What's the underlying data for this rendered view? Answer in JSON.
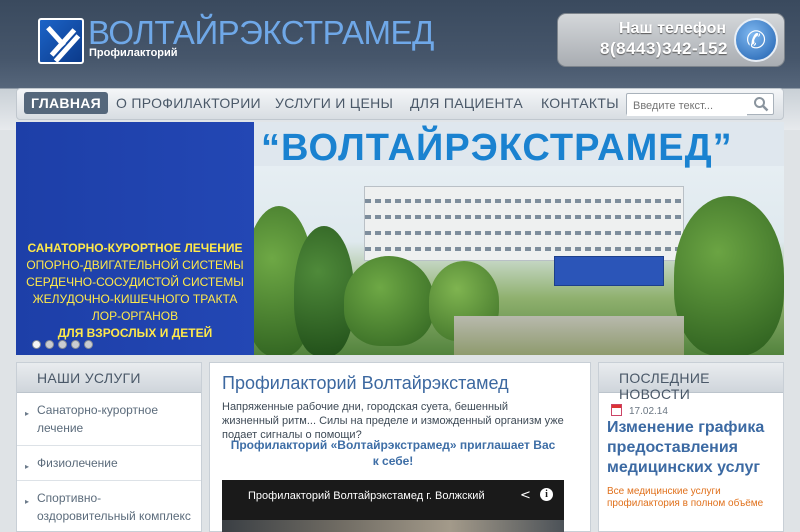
{
  "header": {
    "brand_title": "ВОЛТАЙРЭКСТРАМЕД",
    "brand_subtitle": "Профилакторий",
    "phone_label": "Наш телефон",
    "phone_number": "8(8443)342-152",
    "phone_icon": "phone-handset-icon",
    "logo_icon": "hand-logo-icon"
  },
  "nav": {
    "items": [
      {
        "label": "ГЛАВНАЯ",
        "active": true
      },
      {
        "label": "О ПРОФИЛАКТОРИИ",
        "active": false
      },
      {
        "label": "УСЛУГИ И ЦЕНЫ",
        "active": false
      },
      {
        "label": "ДЛЯ ПАЦИЕНТА",
        "active": false
      },
      {
        "label": "КОНТАКТЫ",
        "active": false
      }
    ],
    "search_placeholder": "Введите текст...",
    "search_icon": "magnifier-icon"
  },
  "banner": {
    "heading": "“ВОЛТАЙРЭКСТРАМЕД”",
    "lines": [
      "САНАТОРНО-КУРОРТНОЕ ЛЕЧЕНИЕ",
      "ОПОРНО-ДВИГАТЕЛЬНОЙ СИСТЕМЫ",
      "СЕРДЕЧНО-СОСУДИСТОЙ СИСТЕМЫ",
      "ЖЕЛУДОЧНО-КИШЕЧНОГО ТРАКТА",
      "ЛОР-ОРГАНОВ",
      "ДЛЯ ВЗРОСЛЫХ И ДЕТЕЙ"
    ],
    "slide_count": 5,
    "active_slide": 1
  },
  "services": {
    "heading": "НАШИ УСЛУГИ",
    "items": [
      "Санаторно-курортное лечение",
      "Физиолечение",
      "Спортивно-оздоровительный комплекс"
    ]
  },
  "main": {
    "title": "Профилакторий Волтайрэкстамед",
    "text": "Напряженные рабочие дни, городская суета, бешенный жизненный ритм... Силы на пределе и изможденный организм уже подает сигналы о помощи?",
    "invite": "Профилакторий «Волтайрэкстрамед» приглашает Вас к себе!",
    "video_title": "Профилакторий Волтайрэкстамед г. Волжский",
    "video_share_icon": "share-icon",
    "video_info_icon": "info-icon"
  },
  "news": {
    "heading": "ПОСЛЕДНИЕ НОВОСТИ",
    "date": "17.02.14",
    "title": "Изменение графика предоставления медицинских услуг",
    "excerpt": "Все медицинские услуги профилактория в полном объёме"
  },
  "colors": {
    "header_bg": "#3a4a5e",
    "brand": "#6fa8e8",
    "banner_blue": "#1d3fa8",
    "banner_heading": "#1a82d0",
    "banner_text": "#ffe94a",
    "link_blue": "#3c6aa3",
    "news_orange": "#e0711c"
  }
}
